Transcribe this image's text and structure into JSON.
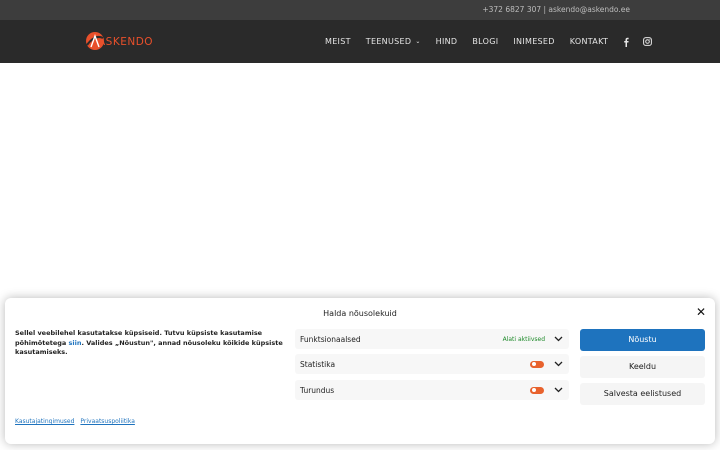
{
  "topbar": {
    "contact": "+372 6827 307 | askendo@askendo.ee"
  },
  "brand": {
    "logo_text": "ASKENDO",
    "accent": "#e8502b"
  },
  "nav": {
    "items": [
      {
        "label": "MEIST"
      },
      {
        "label": "TEENUSED",
        "has_dropdown": true
      },
      {
        "label": "HIND"
      },
      {
        "label": "BLOGI"
      },
      {
        "label": "INIMESED"
      },
      {
        "label": "KONTAKT"
      }
    ],
    "social": [
      {
        "icon": "facebook-icon"
      },
      {
        "icon": "instagram-icon"
      }
    ]
  },
  "consent": {
    "title": "Halda nõusolekuid",
    "message_part1": "Sellel veebilehel kasutatakse küpsiseid. Tutvu küpsiste kasutamise põhimõtetega ",
    "message_link": "siin",
    "message_part2": ". Valides „Nõustun\", annad nõusoleku kõikide küpsiste kasutamiseks.",
    "categories": [
      {
        "name": "Funktsionaalsed",
        "status": "Alati aktiivsed"
      },
      {
        "name": "Statistika",
        "toggle": "on"
      },
      {
        "name": "Turundus",
        "toggle": "on"
      }
    ],
    "accept_label": "Nõustu",
    "deny_label": "Keeldu",
    "save_label": "Salvesta eelistused",
    "footer_links": [
      "Kasutajatingimused",
      "Privaatsuspoliitika"
    ],
    "colors": {
      "primary": "#1e73be",
      "toggle": "#e8622d",
      "always_active": "#1e8a2a"
    }
  }
}
